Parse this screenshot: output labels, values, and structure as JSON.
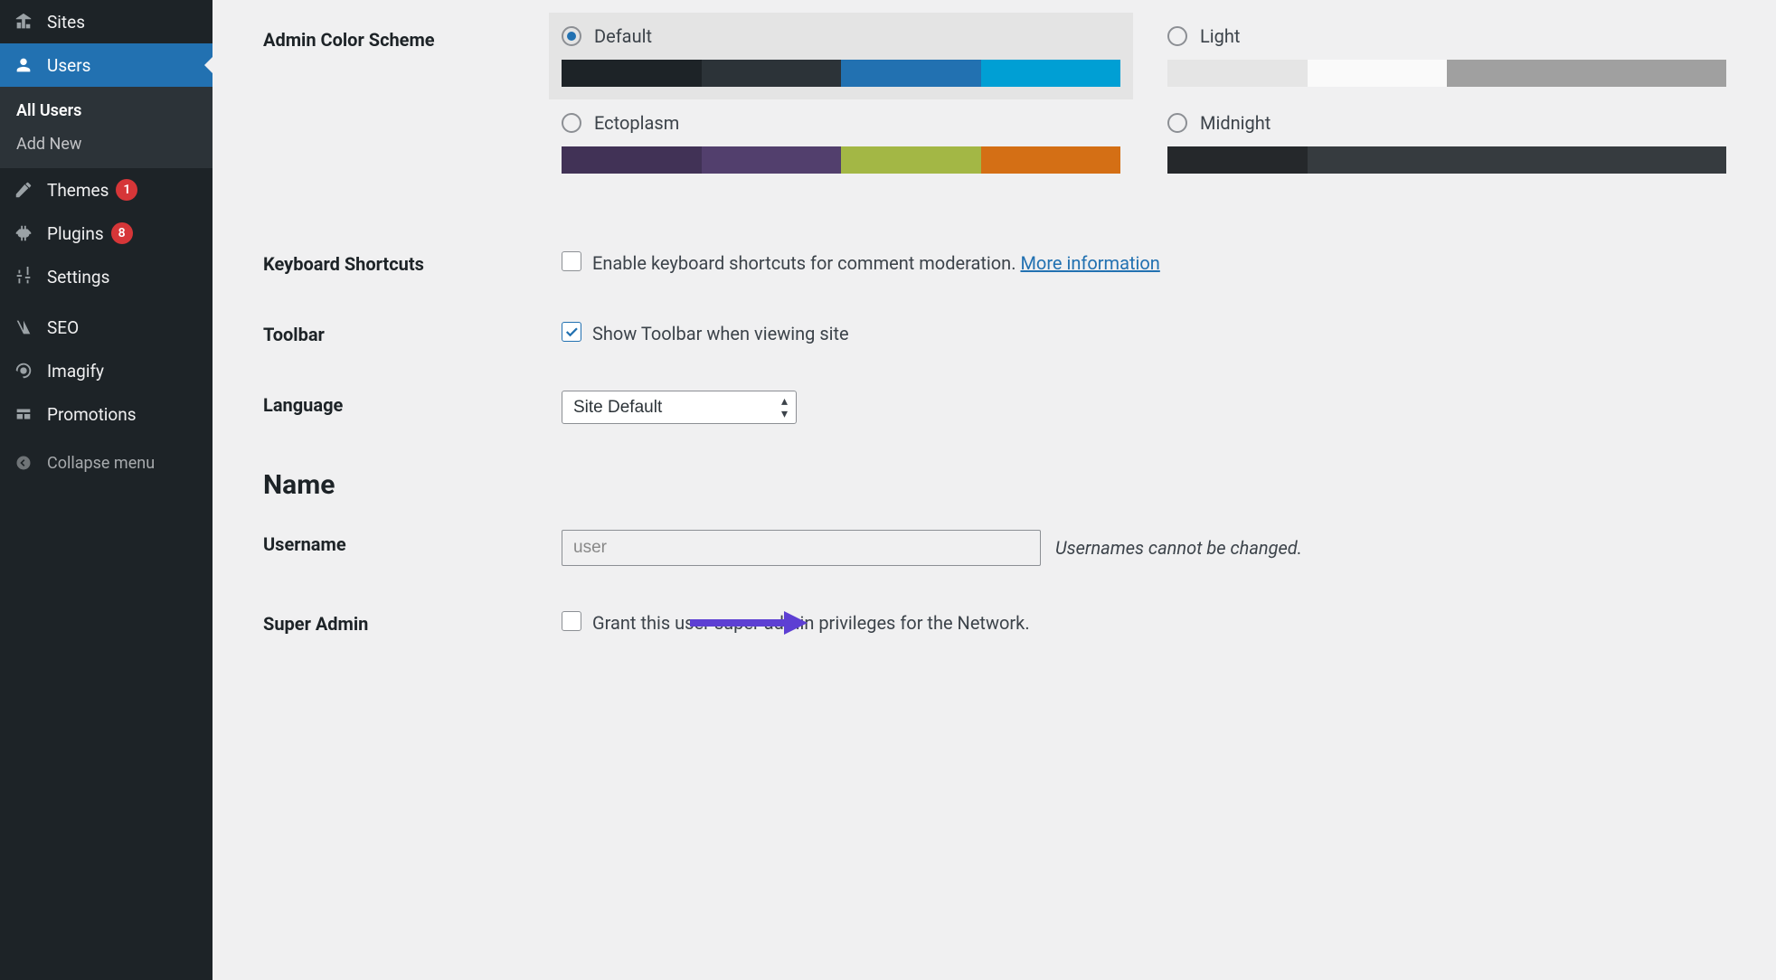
{
  "sidebar": {
    "items": [
      {
        "icon": "sites-icon",
        "label": "Sites"
      },
      {
        "icon": "users-icon",
        "label": "Users",
        "active": true
      },
      {
        "icon": "themes-icon",
        "label": "Themes",
        "badge": "1"
      },
      {
        "icon": "plugins-icon",
        "label": "Plugins",
        "badge": "8"
      },
      {
        "icon": "settings-icon",
        "label": "Settings"
      },
      {
        "icon": "seo-icon",
        "label": "SEO"
      },
      {
        "icon": "imagify-icon",
        "label": "Imagify"
      },
      {
        "icon": "promotions-icon",
        "label": "Promotions"
      }
    ],
    "submenu": [
      {
        "label": "All Users",
        "current": true
      },
      {
        "label": "Add New"
      }
    ],
    "collapse": "Collapse menu"
  },
  "form": {
    "color_scheme": {
      "label": "Admin Color Scheme",
      "options": [
        {
          "name": "Default",
          "selected": true,
          "colors": [
            "#1d2327",
            "#2c3338",
            "#2271b1",
            "#009fd4"
          ]
        },
        {
          "name": "Light",
          "colors": [
            "#e5e5e5",
            "#fafafa",
            "#a0a0a0",
            "#a0a0a0"
          ]
        },
        {
          "name": "Ectoplasm",
          "colors": [
            "#413256",
            "#523f6d",
            "#a3b745",
            "#d46f15"
          ]
        },
        {
          "name": "Midnight",
          "colors": [
            "#25282b",
            "#363b3f",
            "#363b3f",
            "#363b3f"
          ]
        }
      ]
    },
    "shortcuts": {
      "label": "Keyboard Shortcuts",
      "checkbox_label": "Enable keyboard shortcuts for comment moderation.",
      "link": "More information"
    },
    "toolbar": {
      "label": "Toolbar",
      "checkbox_label": "Show Toolbar when viewing site",
      "checked": true
    },
    "language": {
      "label": "Language",
      "selected": "Site Default"
    },
    "section_name": "Name",
    "username": {
      "label": "Username",
      "value": "user",
      "hint": "Usernames cannot be changed."
    },
    "super_admin": {
      "label": "Super Admin",
      "checkbox_label": "Grant this user super admin privileges for the Network."
    }
  }
}
